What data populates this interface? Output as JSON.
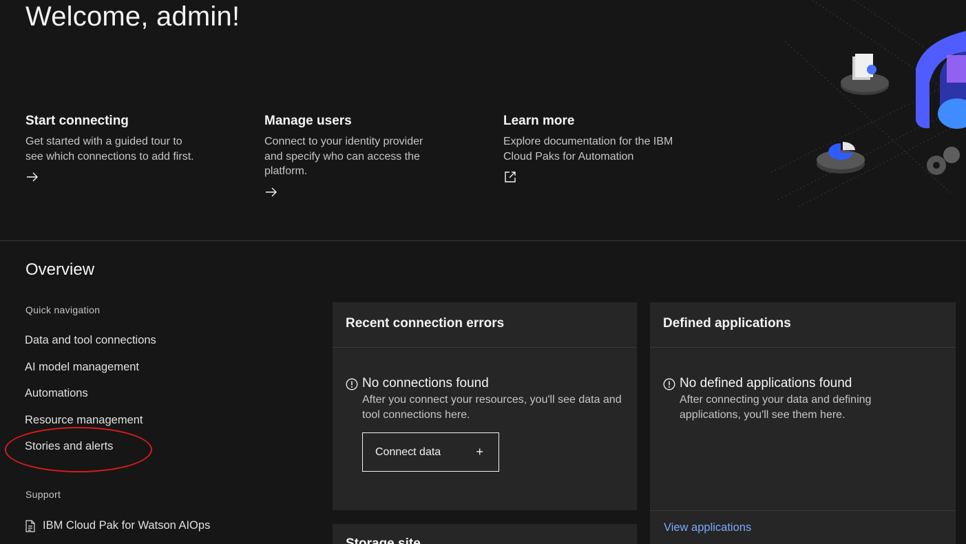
{
  "hero": {
    "welcome": "Welcome, admin!",
    "tiles": [
      {
        "title": "Start connecting",
        "description": "Get started with a guided tour to see which connections to add first.",
        "icon": "arrow-right-icon"
      },
      {
        "title": "Manage users",
        "description": "Connect to your identity provider and specify who can access the platform.",
        "icon": "arrow-right-icon"
      },
      {
        "title": "Learn more",
        "description": "Explore documentation for the IBM Cloud Paks for Automation",
        "icon": "launch-icon"
      }
    ]
  },
  "overview": {
    "title": "Overview",
    "quick_nav_label": "Quick navigation",
    "quick_nav": [
      "Data and tool connections",
      "AI model management",
      "Automations",
      "Resource management",
      "Stories and alerts"
    ],
    "support_label": "Support",
    "support_links": [
      "IBM Cloud Pak for Watson AIOps"
    ]
  },
  "cards": {
    "connection_errors": {
      "title": "Recent connection errors",
      "empty_title": "No connections found",
      "empty_description": "After you connect your resources, you'll see data and tool connections here.",
      "button_label": "Connect data",
      "button_icon": "add-icon"
    },
    "applications": {
      "title": "Defined applications",
      "empty_title": "No defined applications found",
      "empty_description": "After connecting your data and defining applications, you'll see them here.",
      "link_label": "View applications"
    },
    "storage": {
      "title": "Storage site"
    }
  },
  "colors": {
    "background": "#161616",
    "card": "#262626",
    "link": "#78a9ff",
    "annotation": "#d91a1a"
  }
}
